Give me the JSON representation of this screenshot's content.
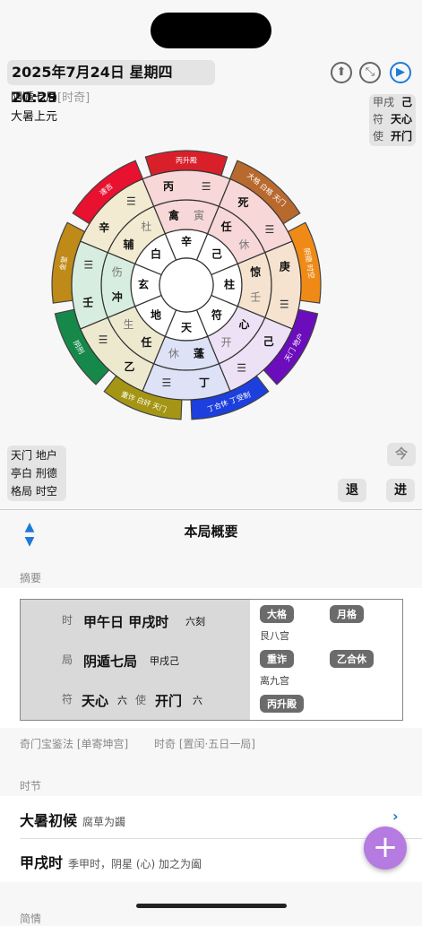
{
  "header": {
    "datetime": "2025年7月24日 星期四 20:29",
    "ju": "阴遁七局",
    "ju_note": "[时奇]",
    "yuan": "大暑上元",
    "top_right": [
      {
        "k": "甲戌",
        "v": "己"
      },
      {
        "k": "符",
        "v": "天心"
      },
      {
        "k": "使",
        "v": "开门"
      }
    ],
    "bottom_left": [
      "天门 地户",
      "亭白 刑德",
      "格局 时空"
    ],
    "today": "今",
    "back": "退",
    "forward": "进"
  },
  "wheel": {
    "outer_tabs": [
      {
        "label": "丙升殿",
        "color": "#d9202a"
      },
      {
        "label": "大格 白格 天门 地户 官符",
        "color": "#b8692e"
      },
      {
        "label": "阴德 时空",
        "color": "#f08a17"
      },
      {
        "label": "天门 地户",
        "color": "#6b0dbd"
      },
      {
        "label": "丁合休 丁受制",
        "color": "#1d3fde"
      },
      {
        "label": "重诈 白奸 天门 地户 乙合休",
        "color": "#a59514"
      },
      {
        "label": "阴刑",
        "color": "#16894a"
      },
      {
        "label": "金堂",
        "color": "#c08a18"
      },
      {
        "label": "速吉",
        "color": "#e8112f"
      }
    ],
    "cells": [
      {
        "name": "离",
        "a": "丙",
        "b": "寅",
        "c": "禽",
        "d": "辛"
      },
      {
        "name": "坤",
        "a": "死",
        "b": "休",
        "c": "任",
        "d": "己"
      },
      {
        "name": "兑",
        "a": "庚",
        "b": "壬",
        "c": "惊",
        "d": "柱"
      },
      {
        "name": "乾",
        "a": "己",
        "b": "开",
        "c": "心",
        "d": "符"
      },
      {
        "name": "坎",
        "a": "丁",
        "b": "休",
        "c": "蓬",
        "d": "天"
      },
      {
        "name": "艮",
        "a": "乙",
        "b": "生",
        "c": "任",
        "d": "地"
      },
      {
        "name": "震",
        "a": "壬",
        "b": "伤",
        "c": "冲",
        "d": "玄"
      },
      {
        "name": "巽",
        "a": "辛",
        "b": "杜",
        "c": "辅",
        "d": "白"
      }
    ],
    "center": ""
  },
  "panel": {
    "title": "本局概要",
    "summary_label": "摘要",
    "shi_label": "时",
    "shi_value": "甲午日 甲戌时",
    "shi_extra": "六刻",
    "ju_label": "局",
    "ju_value": "阴遁七局",
    "ju_extra": "甲戌己",
    "fu_label": "符",
    "fu_value": "天心",
    "fu_num": "六",
    "shi2_label": "使",
    "shi2_value": "开门",
    "shi2_num": "六",
    "tags": [
      {
        "label": "大格",
        "palace": "艮八宫"
      },
      {
        "label": "月格",
        "palace": ""
      },
      {
        "label": "重诈",
        "palace": "离九宫"
      },
      {
        "label": "乙合休",
        "palace": ""
      },
      {
        "label": "丙升殿",
        "palace": ""
      }
    ],
    "method": "奇门宝鉴法 [单寄坤宫]",
    "shike": "时奇 [置闰·五日一局]",
    "jieqi_label": "时节",
    "hou_title": "大暑初候",
    "hou_sub": "腐草为蠲",
    "hour_title": "甲戌时",
    "hour_sub": "季甲时，阴星 (心) 加之为阖",
    "next_label": "简情"
  },
  "colors": {
    "accent": "#1e7ad6",
    "fab": "#b57be0"
  },
  "icons": [
    "compass-icon",
    "shrink-icon",
    "gear-icon",
    "swap-icon",
    "plus-icon",
    "chevron-right-icon"
  ]
}
